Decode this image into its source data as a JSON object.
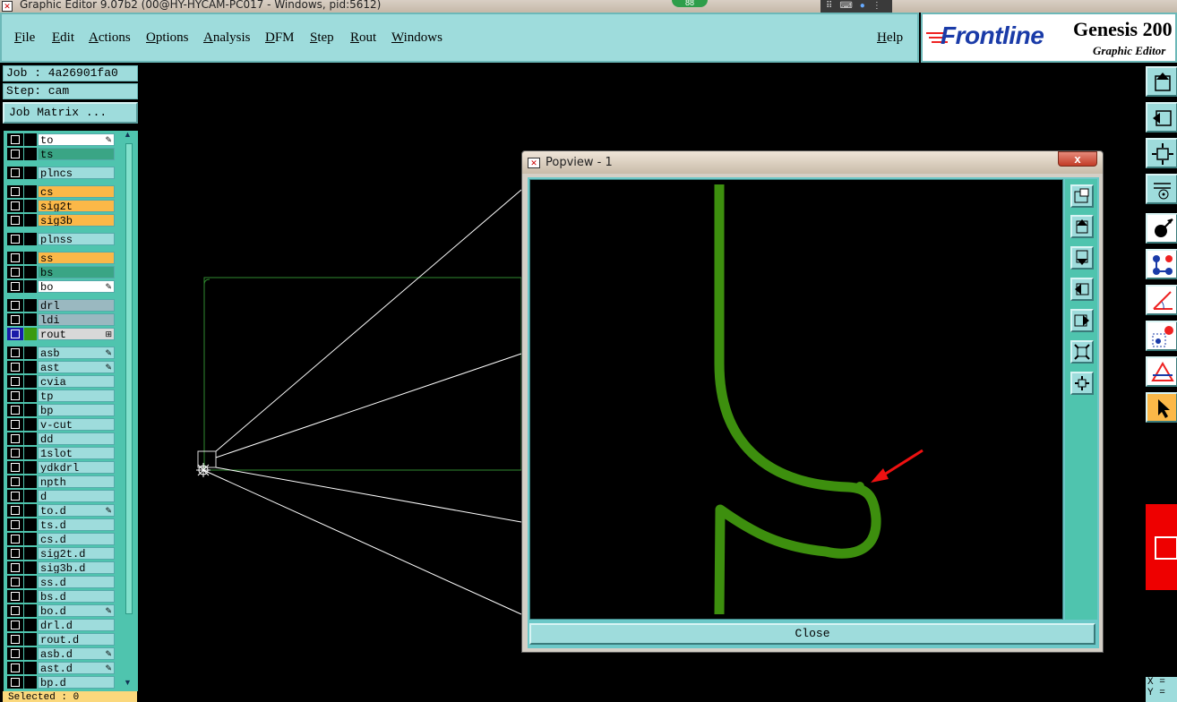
{
  "window": {
    "title": "Graphic Editor 9.07b2 (00@HY-HYCAM-PC017 - Windows, pid:5612)",
    "tray_badge": "88"
  },
  "menu": {
    "items": [
      "File",
      "Edit",
      "Actions",
      "Options",
      "Analysis",
      "DFM",
      "Step",
      "Rout",
      "Windows"
    ],
    "help": "Help"
  },
  "brand": {
    "logo": "Frontline",
    "product": "Genesis 200",
    "subtitle": "Graphic Editor"
  },
  "job": {
    "job_label": "Job : 4a26901fa0",
    "step_label": "Step: cam",
    "matrix_button": "Job Matrix ..."
  },
  "layers": [
    {
      "name": "to",
      "color": "#ffffff",
      "swatch": "#000000",
      "mark": "✎",
      "gap": false
    },
    {
      "name": "ts",
      "color": "#3aa585",
      "swatch": "#000000",
      "mark": "",
      "gap": false
    },
    {
      "name": "plncs",
      "color": "#9edcdc",
      "swatch": "#000000",
      "mark": "",
      "gap": true
    },
    {
      "name": "cs",
      "color": "#fbb848",
      "swatch": "#000000",
      "mark": "",
      "gap": true
    },
    {
      "name": "sig2t",
      "color": "#fbb848",
      "swatch": "#000000",
      "mark": "",
      "gap": false
    },
    {
      "name": "sig3b",
      "color": "#fbb848",
      "swatch": "#000000",
      "mark": "",
      "gap": false
    },
    {
      "name": "plnss",
      "color": "#9edcdc",
      "swatch": "#000000",
      "mark": "",
      "gap": true
    },
    {
      "name": "ss",
      "color": "#fbb848",
      "swatch": "#000000",
      "mark": "",
      "gap": true
    },
    {
      "name": "bs",
      "color": "#3aa585",
      "swatch": "#000000",
      "mark": "",
      "gap": false
    },
    {
      "name": "bo",
      "color": "#ffffff",
      "swatch": "#000000",
      "mark": "✎",
      "gap": false
    },
    {
      "name": "drl",
      "color": "#9ab8c0",
      "swatch": "#000000",
      "mark": "",
      "gap": true
    },
    {
      "name": "ldi",
      "color": "#9ab8c0",
      "swatch": "#000000",
      "mark": "",
      "gap": false
    },
    {
      "name": "rout",
      "color": "#d8d8d8",
      "swatch": "#3a9a10",
      "mark": "⊞",
      "gap": false,
      "active": true
    },
    {
      "name": "asb",
      "color": "#9edcdc",
      "swatch": "#000000",
      "mark": "✎",
      "gap": true
    },
    {
      "name": "ast",
      "color": "#9edcdc",
      "swatch": "#000000",
      "mark": "✎",
      "gap": false
    },
    {
      "name": "cvia",
      "color": "#9edcdc",
      "swatch": "#000000",
      "mark": "",
      "gap": false
    },
    {
      "name": "tp",
      "color": "#9edcdc",
      "swatch": "#000000",
      "mark": "",
      "gap": false
    },
    {
      "name": "bp",
      "color": "#9edcdc",
      "swatch": "#000000",
      "mark": "",
      "gap": false
    },
    {
      "name": "v-cut",
      "color": "#9edcdc",
      "swatch": "#000000",
      "mark": "",
      "gap": false
    },
    {
      "name": "dd",
      "color": "#9edcdc",
      "swatch": "#000000",
      "mark": "",
      "gap": false
    },
    {
      "name": "1slot",
      "color": "#9edcdc",
      "swatch": "#000000",
      "mark": "",
      "gap": false
    },
    {
      "name": "ydkdrl",
      "color": "#9edcdc",
      "swatch": "#000000",
      "mark": "",
      "gap": false
    },
    {
      "name": "npth",
      "color": "#9edcdc",
      "swatch": "#000000",
      "mark": "",
      "gap": false
    },
    {
      "name": "d",
      "color": "#9edcdc",
      "swatch": "#000000",
      "mark": "",
      "gap": false
    },
    {
      "name": "to.d",
      "color": "#9edcdc",
      "swatch": "#000000",
      "mark": "✎",
      "gap": false
    },
    {
      "name": "ts.d",
      "color": "#9edcdc",
      "swatch": "#000000",
      "mark": "",
      "gap": false
    },
    {
      "name": "cs.d",
      "color": "#9edcdc",
      "swatch": "#000000",
      "mark": "",
      "gap": false
    },
    {
      "name": "sig2t.d",
      "color": "#9edcdc",
      "swatch": "#000000",
      "mark": "",
      "gap": false
    },
    {
      "name": "sig3b.d",
      "color": "#9edcdc",
      "swatch": "#000000",
      "mark": "",
      "gap": false
    },
    {
      "name": "ss.d",
      "color": "#9edcdc",
      "swatch": "#000000",
      "mark": "",
      "gap": false
    },
    {
      "name": "bs.d",
      "color": "#9edcdc",
      "swatch": "#000000",
      "mark": "",
      "gap": false
    },
    {
      "name": "bo.d",
      "color": "#9edcdc",
      "swatch": "#000000",
      "mark": "✎",
      "gap": false
    },
    {
      "name": "drl.d",
      "color": "#9edcdc",
      "swatch": "#000000",
      "mark": "",
      "gap": false
    },
    {
      "name": "rout.d",
      "color": "#9edcdc",
      "swatch": "#000000",
      "mark": "",
      "gap": false
    },
    {
      "name": "asb.d",
      "color": "#9edcdc",
      "swatch": "#000000",
      "mark": "✎",
      "gap": false
    },
    {
      "name": "ast.d",
      "color": "#9edcdc",
      "swatch": "#000000",
      "mark": "✎",
      "gap": false
    },
    {
      "name": "bp.d",
      "color": "#9edcdc",
      "swatch": "#000000",
      "mark": "",
      "gap": false
    }
  ],
  "status": {
    "selected": "Selected : 0"
  },
  "popview": {
    "title": "Popview - 1",
    "close_x": "x",
    "close_button": "Close"
  },
  "coords": {
    "x_label": "X =",
    "y_label": "Y ="
  },
  "colors": {
    "panel": "#9edcdc",
    "layer_frame": "#4fc4ae",
    "route_green": "#3d8f0e",
    "arrow_red": "#ee1111"
  }
}
